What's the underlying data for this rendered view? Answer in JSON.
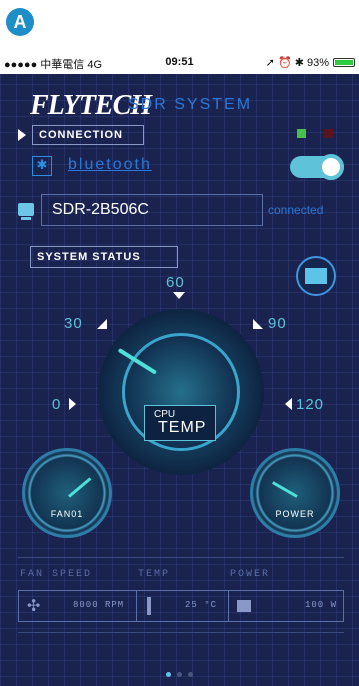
{
  "annotation": {
    "badge": "A"
  },
  "statusbar": {
    "carrier": "●●●●● 中華電信  4G",
    "time": "09:51",
    "icons": "➚ ⏰ ✱ 93%",
    "battery_percent": 93
  },
  "header": {
    "logo": "FLYTECH",
    "subtitle": "SDR SYSTEM"
  },
  "connection": {
    "label": "CONNECTION",
    "indicators": {
      "green": "#48c14a",
      "red": "#5a1420"
    },
    "bluetooth_label": "bluetooth",
    "bluetooth_enabled": true,
    "device_name": "SDR-2B506C",
    "device_status": "connected"
  },
  "system": {
    "label": "SYSTEM STATUS",
    "gauge": {
      "ticks": [
        "60",
        "30",
        "90",
        "0",
        "120"
      ],
      "title_small": "CPU",
      "title": "TEMP"
    },
    "fan_label": "FAN01",
    "power_label": "POWER"
  },
  "stats": {
    "headers": [
      "FAN SPEED",
      "TEMP",
      "POWER"
    ],
    "fan_speed": "8000 RPM",
    "temp": "25 °C",
    "power": "100 W"
  },
  "pager": {
    "pages": 3,
    "current": 1
  },
  "colors": {
    "background": "#1a2350",
    "accent": "#5ec3d8",
    "link": "#2b78d8"
  }
}
